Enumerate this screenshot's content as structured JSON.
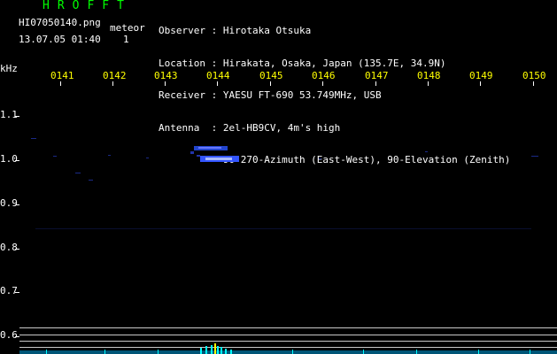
{
  "header": {
    "app_title": "HROFFT",
    "filename": "HI07050140.png",
    "timestamp": "13.07.05 01:40",
    "meteor_label": "meteor",
    "meteor_count": "1"
  },
  "observer_info": {
    "lines": [
      "Observer : Hirotaka Otsuka",
      "Location : Hirakata, Osaka, Japan (135.7E, 34.9N)",
      "Receiver : YAESU FT-690 53.749MHz, USB",
      "Antenna  : 2el-HB9CV, 4m's high",
      "           90-270-Azimuth (East-West), 90-Elevation (Zenith)"
    ]
  },
  "axes": {
    "freq_unit": "kHz",
    "time_ticks": [
      "0141",
      "0142",
      "0143",
      "0144",
      "0145",
      "0146",
      "0147",
      "0148",
      "0149",
      "0150"
    ],
    "freq_ticks": [
      "1.1",
      "1.0",
      "0.9",
      "0.8",
      "0.7",
      "0.6"
    ]
  },
  "colors": {
    "background": "#000000",
    "text_white": "#ffffff",
    "text_yellow": "#ffff00",
    "title_green": "#00ff00",
    "echo_blue": "#3355ff",
    "echo_core": "#aabbff",
    "noise_cyan": "#00ffff"
  }
}
